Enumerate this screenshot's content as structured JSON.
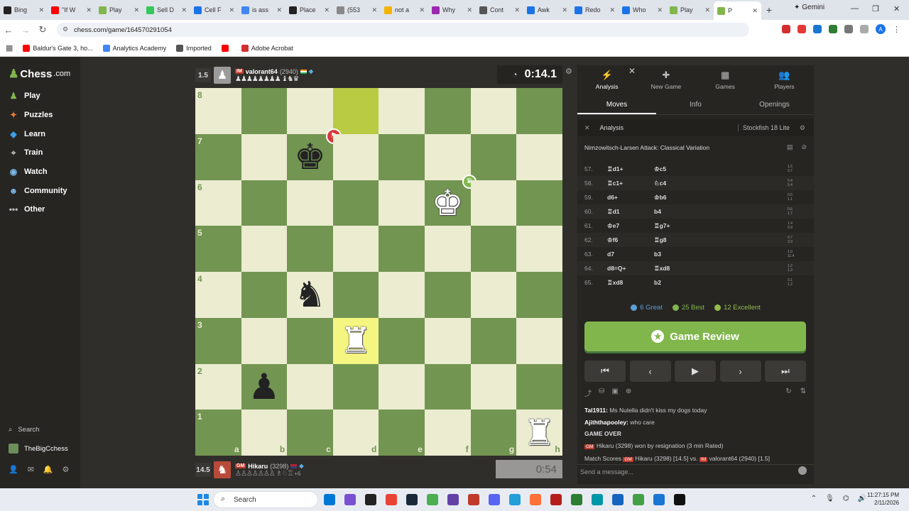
{
  "tabs": [
    {
      "label": "Bing",
      "color": "#222"
    },
    {
      "label": "\"If W",
      "color": "#ff0000"
    },
    {
      "label": "Play",
      "color": "#81b64c"
    },
    {
      "label": "Sell D",
      "color": "#34c759"
    },
    {
      "label": "Cell F",
      "color": "#1a73e8"
    },
    {
      "label": "is ass",
      "color": "#4285f4"
    },
    {
      "label": "Place",
      "color": "#222"
    },
    {
      "label": "(553",
      "color": "#888"
    },
    {
      "label": "not a",
      "color": "#f4b400"
    },
    {
      "label": "Why",
      "color": "#9c27b0"
    },
    {
      "label": "Cont",
      "color": "#555"
    },
    {
      "label": "Awk",
      "color": "#1a73e8"
    },
    {
      "label": "Redo",
      "color": "#1a73e8"
    },
    {
      "label": "Who",
      "color": "#1a73e8"
    },
    {
      "label": "Play",
      "color": "#81b64c"
    },
    {
      "label": "P",
      "color": "#81b64c"
    }
  ],
  "browser": {
    "new_tab": "+",
    "gemini": "Gemini",
    "url": "chess.com/game/164570291054",
    "profile_initial": "A",
    "bookmarks": [
      {
        "label": "Baldur's Gate 3, ho...",
        "color": "#ff0000"
      },
      {
        "label": "Analytics Academy",
        "color": "#4285f4"
      },
      {
        "label": "Imported",
        "color": "#555"
      },
      {
        "label": "",
        "color": "#ff0000"
      },
      {
        "label": "Adobe Acrobat",
        "color": "#d32f2f"
      }
    ]
  },
  "sidebar": {
    "logo": "Chess",
    "logo_domain": ".com",
    "items": [
      {
        "label": "Play",
        "icon": "♟",
        "color": "#81b64c"
      },
      {
        "label": "Puzzles",
        "icon": "✦",
        "color": "#f07b2c"
      },
      {
        "label": "Learn",
        "icon": "◆",
        "color": "#3aa0e8"
      },
      {
        "label": "Train",
        "icon": "⌖",
        "color": "#bbb"
      },
      {
        "label": "Watch",
        "icon": "◉",
        "color": "#7ab8e8"
      },
      {
        "label": "Community",
        "icon": "☻",
        "color": "#7ab8e8"
      },
      {
        "label": "Other",
        "icon": "•••",
        "color": "#bbb"
      }
    ],
    "search": "Search",
    "username": "TheBigCchess"
  },
  "top_player": {
    "score": "1.5",
    "title": "IM",
    "name": "valorant64",
    "rating": "(2940)",
    "captured": "♟♟♟♟♟♟♟♟ ♝♞♛",
    "clock": "0:14.1"
  },
  "bottom_player": {
    "score": "14.5",
    "title": "GM",
    "name": "Hikaru",
    "rating": "(3298)",
    "captured": "♙♙♙♙♙♙♙ ♗♘♖",
    "extra": "+6",
    "clock": "0:54"
  },
  "board": {
    "ranks": [
      "8",
      "7",
      "6",
      "5",
      "4",
      "3",
      "2",
      "1"
    ],
    "files": [
      "a",
      "b",
      "c",
      "d",
      "e",
      "f",
      "g",
      "h"
    ],
    "pieces": [
      {
        "sq": "c7",
        "glyph": "♚",
        "color": "b"
      },
      {
        "sq": "f6",
        "glyph": "♚",
        "color": "w"
      },
      {
        "sq": "c4",
        "glyph": "♞",
        "color": "b"
      },
      {
        "sq": "d3",
        "glyph": "♜",
        "color": "w"
      },
      {
        "sq": "b2",
        "glyph": "♟",
        "color": "b"
      },
      {
        "sq": "h1",
        "glyph": "♜",
        "color": "w"
      }
    ],
    "highlights": [
      "d8",
      "d3"
    ],
    "flag_marker": "⚑",
    "crown_marker": "♛"
  },
  "panel": {
    "tabs": [
      {
        "label": "Analysis",
        "icon": "⚡"
      },
      {
        "label": "New Game",
        "icon": "✚"
      },
      {
        "label": "Games",
        "icon": "▦"
      },
      {
        "label": "Players",
        "icon": "👥"
      }
    ],
    "close": "✕",
    "subtabs": [
      "Moves",
      "Info",
      "Openings"
    ],
    "analysis_label": "Analysis",
    "engine": "Stockfish 18 Lite",
    "opening": "Nimzowitsch-Larsen Attack: Classical Variation",
    "moves": [
      {
        "n": "57.",
        "w": "♖d1+",
        "b": "♔c5",
        "e1": "1.5",
        "e2": "0.7"
      },
      {
        "n": "58.",
        "w": "♖c1+",
        "b": "♘c4",
        "e1": "0.4",
        "e2": "5.4"
      },
      {
        "n": "59.",
        "w": "d6+",
        "b": "♔b6",
        "e1": "0.5",
        "e2": "1.1"
      },
      {
        "n": "60.",
        "w": "♖d1",
        "b": "b4",
        "e1": "0.6",
        "e2": "1.7"
      },
      {
        "n": "61.",
        "w": "♔e7",
        "b": "♖g7+",
        "e1": "1.4",
        "e2": "0.9"
      },
      {
        "n": "62.",
        "w": "♔f6",
        "b": "♖g8",
        "e1": "0.7",
        "e2": "3.9"
      },
      {
        "n": "63.",
        "w": "d7",
        "b": "b3",
        "e1": "1.0",
        "e2": "11.4"
      },
      {
        "n": "64.",
        "w": "d8=Q+",
        "b": "♖xd8",
        "e1": "1.2",
        "e2": "1.3"
      },
      {
        "n": "65.",
        "w": "♖xd8",
        "b": "b2",
        "e1": "0.1",
        "e2": "1.2"
      }
    ],
    "stats": [
      {
        "label": "6 Great",
        "color": "#5d9fd6"
      },
      {
        "label": "25 Best",
        "color": "#81b64c"
      },
      {
        "label": "12 Excellent",
        "color": "#96bc4b"
      }
    ],
    "review": "Game Review",
    "controls": [
      "⏮",
      "‹",
      "▶",
      "›",
      "⏭"
    ],
    "chat": [
      {
        "user": "Tal1911:",
        "text": " Ms Nutella didn't kiss my dogs today"
      },
      {
        "user": "Ajiththapooley:",
        "text": " who care"
      }
    ],
    "game_over": "GAME OVER",
    "result_prefix": "GM",
    "result": " Hikaru (3298) won by resignation (3 min Rated)",
    "match_scores_label": "Match Scores ",
    "match_gm": "GM",
    "match_p1": " Hikaru (3298) [14.5] vs. ",
    "match_im": "IM",
    "match_p2": " valorant64 (2940) [1.5]",
    "chat_placeholder": "Send a message..."
  },
  "taskbar": {
    "search": "Search",
    "time": "11:27:15 PM",
    "date": "2/11/2026"
  }
}
